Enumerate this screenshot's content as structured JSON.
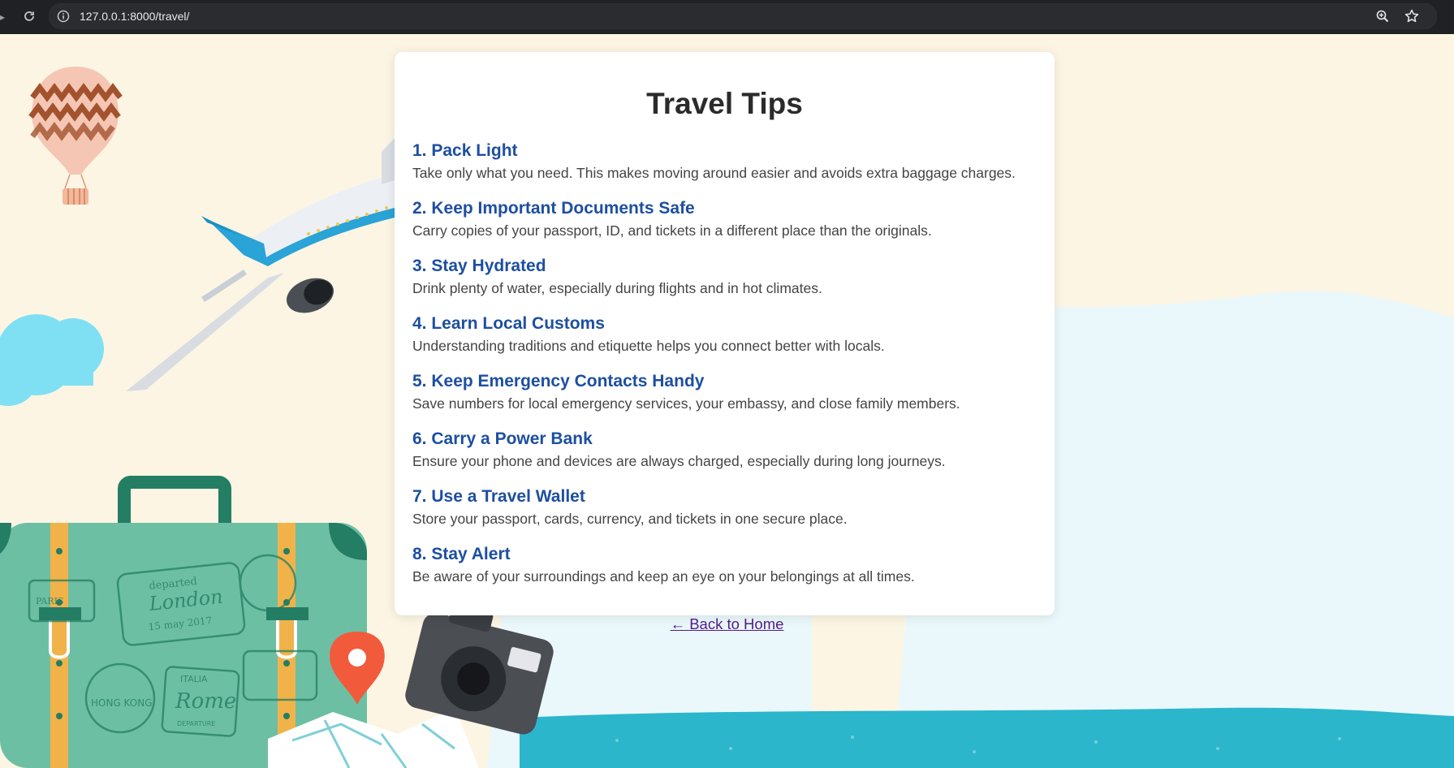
{
  "browser": {
    "url": "127.0.0.1:8000/travel/"
  },
  "page": {
    "title": "Travel Tips",
    "tips": [
      {
        "title": "1. Pack Light",
        "text": "Take only what you need. This makes moving around easier and avoids extra baggage charges."
      },
      {
        "title": "2. Keep Important Documents Safe",
        "text": "Carry copies of your passport, ID, and tickets in a different place than the originals."
      },
      {
        "title": "3. Stay Hydrated",
        "text": "Drink plenty of water, especially during flights and in hot climates."
      },
      {
        "title": "4. Learn Local Customs",
        "text": "Understanding traditions and etiquette helps you connect better with locals."
      },
      {
        "title": "5. Keep Emergency Contacts Handy",
        "text": "Save numbers for local emergency services, your embassy, and close family members."
      },
      {
        "title": "6. Carry a Power Bank",
        "text": "Ensure your phone and devices are always charged, especially during long journeys."
      },
      {
        "title": "7. Use a Travel Wallet",
        "text": "Store your passport, cards, currency, and tickets in one secure place."
      },
      {
        "title": "8. Stay Alert",
        "text": "Be aware of your surroundings and keep an eye on your belongings at all times."
      }
    ],
    "back_link": "← Back to Home"
  },
  "background": {
    "stamps": {
      "departed": "departed",
      "london": "London",
      "date": "15 may 2017",
      "hongkong": "HONG KONG",
      "italia": "ITALIA",
      "rome": "Rome",
      "departure": "DEPARTURE",
      "paris": "PARIS"
    }
  },
  "colors": {
    "heading": "#2b2b2b",
    "tip_title": "#1d4fa0",
    "tip_text": "#444444",
    "link_visited": "#551a8b",
    "background": "#fcf5e3",
    "suitcase": "#6dbfa3",
    "sea": "#2bb6cc"
  }
}
